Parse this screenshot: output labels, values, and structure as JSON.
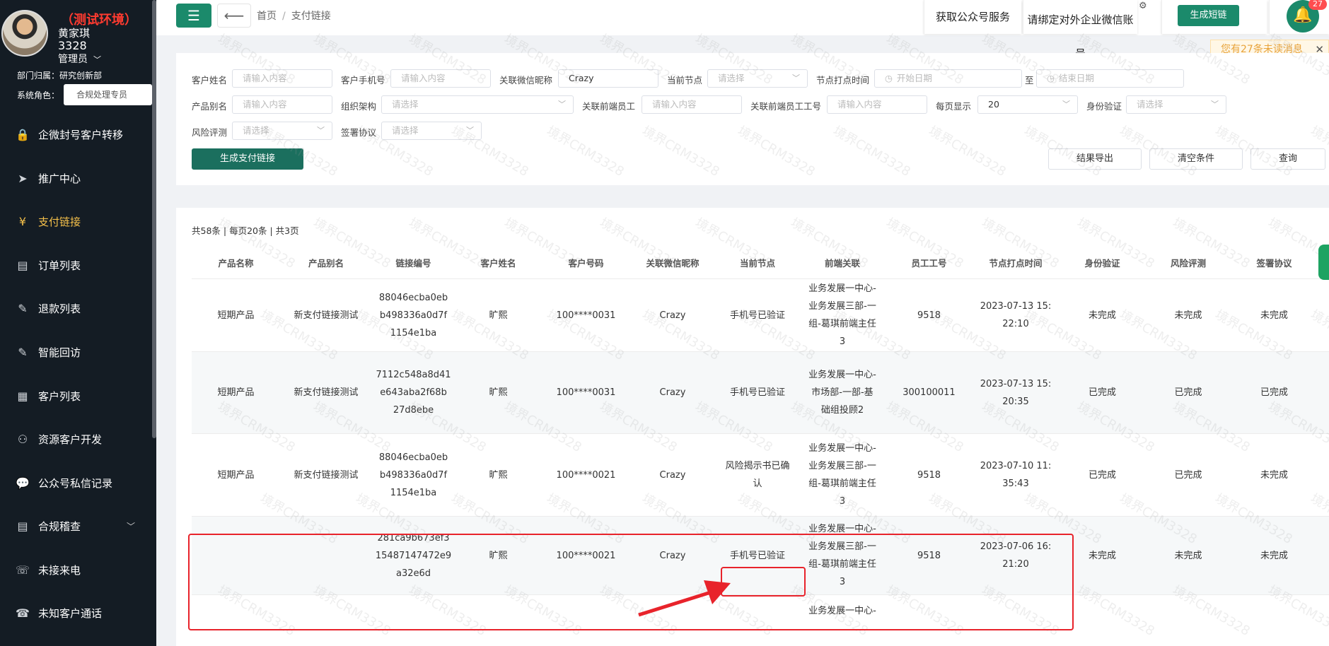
{
  "sidebar": {
    "env_label": "（测试环境）",
    "user_name": "黄家琪",
    "user_id": "3328",
    "user_role": "管理员",
    "dept": "部门归属：研究创新部",
    "sys_role_label": "系统角色：",
    "sys_role_value": "合规处理专员",
    "items": [
      {
        "label": "企微封号客户转移",
        "icon": "lock-icon"
      },
      {
        "label": "推广中心",
        "icon": "send-icon"
      },
      {
        "label": "支付链接",
        "icon": "yen-icon"
      },
      {
        "label": "订单列表",
        "icon": "clipboard-icon"
      },
      {
        "label": "退款列表",
        "icon": "edit-icon"
      },
      {
        "label": "智能回访",
        "icon": "edit-icon"
      },
      {
        "label": "客户列表",
        "icon": "grid-icon"
      },
      {
        "label": "资源客户开发",
        "icon": "users-icon"
      },
      {
        "label": "公众号私信记录",
        "icon": "chat-icon"
      },
      {
        "label": "合规稽查",
        "icon": "document-icon"
      },
      {
        "label": "未接来电",
        "icon": "phone-missed-icon"
      },
      {
        "label": "未知客户通话",
        "icon": "phone-icon"
      }
    ]
  },
  "topbar": {
    "breadcrumb_home": "首页",
    "breadcrumb_sep": "/",
    "breadcrumb_current": "支付链接",
    "btn_wechat_service": "获取公众号服务",
    "btn_bind_wecom": "请绑定对外企业微信账号",
    "btn_short_link": "生成短链",
    "notify_count": "27"
  },
  "notice": "您有27条未读消息",
  "filters": {
    "customer_name": {
      "label": "客户姓名",
      "placeholder": "请输入内容"
    },
    "customer_phone": {
      "label": "客户手机号",
      "placeholder": "请输入内容"
    },
    "wechat_nick": {
      "label": "关联微信昵称",
      "value": "Crazy"
    },
    "current_node": {
      "label": "当前节点",
      "placeholder": "请选择"
    },
    "node_time": {
      "label": "节点打点时间",
      "start": "开始日期",
      "to": "至",
      "end": "结束日期"
    },
    "product_alias": {
      "label": "产品别名",
      "placeholder": "请输入内容"
    },
    "org": {
      "label": "组织架构",
      "placeholder": "请选择"
    },
    "frontend_staff": {
      "label": "关联前端员工",
      "placeholder": "请输入内容"
    },
    "frontend_staff_no": {
      "label": "关联前端员工工号",
      "placeholder": "请输入内容"
    },
    "page_size": {
      "label": "每页显示",
      "value": "20"
    },
    "id_verify": {
      "label": "身份验证",
      "placeholder": "请选择"
    },
    "risk_eval": {
      "label": "风险评测",
      "placeholder": "请选择"
    },
    "sign_agreement": {
      "label": "签署协议",
      "placeholder": "请选择"
    },
    "btn_generate": "生成支付链接",
    "btn_export": "结果导出",
    "btn_clear": "清空条件",
    "btn_query": "查询"
  },
  "table": {
    "summary": "共58条 | 每页20条 | 共3页",
    "headers": [
      "产品名称",
      "产品别名",
      "链接编号",
      "客户姓名",
      "客户号码",
      "关联微信昵称",
      "当前节点",
      "前端关联",
      "员工工号",
      "节点打点时间",
      "身份验证",
      "风险评测",
      "签署协议"
    ],
    "rows": [
      {
        "product": "短期产品",
        "alias": "新支付链接测试",
        "link_id": [
          "88046ecba0eb",
          "b498336a0d7f",
          "1154e1ba"
        ],
        "name": "旷熙",
        "phone": "100****0031",
        "nick": "Crazy",
        "node": [
          "手机号已验证"
        ],
        "frontend": [
          "业务发展一中心-",
          "业务发展三部-一",
          "组-葛琪前端主任",
          "3"
        ],
        "staff_no": "9518",
        "time": [
          "2023-07-13 15:",
          "22:10"
        ],
        "id_verify": "未完成",
        "risk": "未完成",
        "sign": "未完成"
      },
      {
        "product": "短期产品",
        "alias": "新支付链接测试",
        "link_id": [
          "7112c548a8d41",
          "e643aba2f68b",
          "27d8ebe"
        ],
        "name": "旷熙",
        "phone": "100****0031",
        "nick": "Crazy",
        "node": [
          "手机号已验证"
        ],
        "frontend": [
          "业务发展一中心-",
          "市场部-一部-基",
          "础组投顾2"
        ],
        "staff_no": "300100011",
        "time": [
          "2023-07-13 15:",
          "20:35"
        ],
        "id_verify": "已完成",
        "risk": "已完成",
        "sign": "已完成"
      },
      {
        "product": "短期产品",
        "alias": "新支付链接测试",
        "link_id": [
          "88046ecba0eb",
          "b498336a0d7f",
          "1154e1ba"
        ],
        "name": "旷熙",
        "phone": "100****0021",
        "nick": "Crazy",
        "node": [
          "风险揭示书已确",
          "认"
        ],
        "frontend": [
          "业务发展一中心-",
          "业务发展三部-一",
          "组-葛琪前端主任",
          "3"
        ],
        "staff_no": "9518",
        "time": [
          "2023-07-10 11:",
          "35:43"
        ],
        "id_verify": "已完成",
        "risk": "已完成",
        "sign": "未完成"
      },
      {
        "product": "",
        "alias": "",
        "link_id": [
          "281ca9b673ef3",
          "15487147472e9",
          "a32e6d"
        ],
        "name": "旷熙",
        "phone": "100****0021",
        "nick": "Crazy",
        "node": [
          "手机号已验证"
        ],
        "frontend": [
          "业务发展一中心-",
          "业务发展三部-一",
          "组-葛琪前端主任",
          "3"
        ],
        "staff_no": "9518",
        "time": [
          "2023-07-06 16:",
          "21:20"
        ],
        "id_verify": "未完成",
        "risk": "未完成",
        "sign": "未完成"
      },
      {
        "product": "",
        "alias": "",
        "link_id": [],
        "name": "",
        "phone": "",
        "nick": "",
        "node": [],
        "frontend": [
          "业务发展一中心-"
        ],
        "staff_no": "",
        "time": [],
        "id_verify": "",
        "risk": "",
        "sign": ""
      }
    ]
  },
  "watermark_text": "境界CRM3328",
  "colors": {
    "primary": "#1b8a6b",
    "sidebar_bg": "#141c24",
    "active_menu": "#f5c04a",
    "env_text": "#ff3b30",
    "annotation": "#e8232b"
  }
}
